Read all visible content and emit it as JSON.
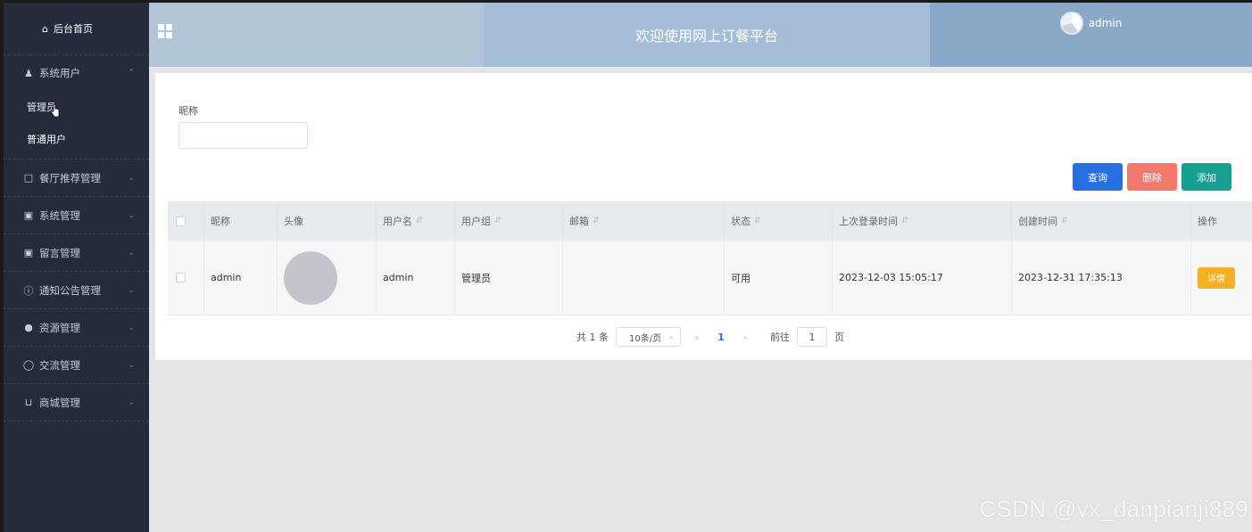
{
  "sidebar": {
    "home": "后台首页",
    "system_users": {
      "label": "系统用户",
      "children": [
        "管理员",
        "普通用户"
      ]
    },
    "menus": [
      {
        "label": "餐厅推荐管理",
        "icon": "share-icon"
      },
      {
        "label": "系统管理",
        "icon": "image-icon"
      },
      {
        "label": "留言管理",
        "icon": "image-icon"
      },
      {
        "label": "通知公告管理",
        "icon": "info-icon"
      },
      {
        "label": "资源管理",
        "icon": "location-icon"
      },
      {
        "label": "交流管理",
        "icon": "chat-icon"
      },
      {
        "label": "商城管理",
        "icon": "cart-icon"
      }
    ]
  },
  "header": {
    "title": "欢迎使用网上订餐平台",
    "user": "admin"
  },
  "search": {
    "label": "昵称",
    "value": ""
  },
  "toolbar": {
    "query": "查询",
    "delete": "删除",
    "add": "添加"
  },
  "table": {
    "headers": [
      "昵称",
      "头像",
      "用户名",
      "用户组",
      "邮箱",
      "状态",
      "上次登录时间",
      "创建时间",
      "操作"
    ],
    "rows": [
      {
        "nickname": "admin",
        "username": "admin",
        "group": "管理员",
        "email": "",
        "status": "可用",
        "last_login": "2023-12-03 15:05:17",
        "created": "2023-12-31 17:35:13",
        "action": "详情"
      }
    ]
  },
  "pagination": {
    "total": "共 1 条",
    "page_size": "10条/页",
    "current": "1",
    "goto_prefix": "前往",
    "goto_value": "1",
    "goto_suffix": "页"
  },
  "watermark": "CSDN @vx_danpianji889"
}
